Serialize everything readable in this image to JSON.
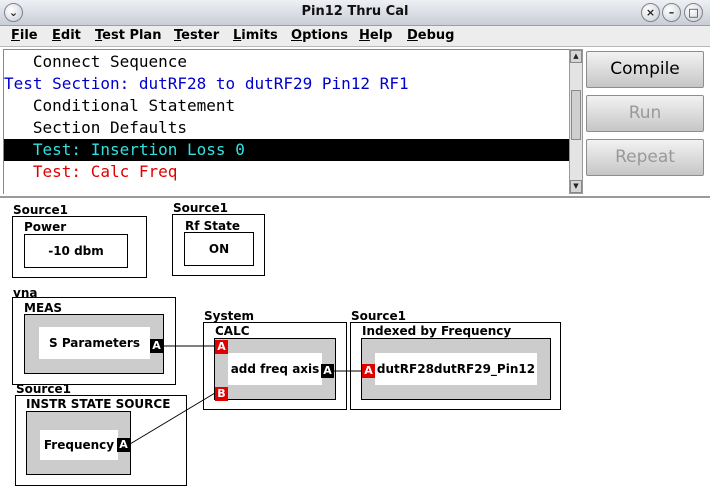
{
  "window": {
    "title": "Pin12 Thru Cal"
  },
  "menu": [
    "File",
    "Edit",
    "Test Plan",
    "Tester",
    "Limits",
    "Options",
    "Help",
    "Debug"
  ],
  "sequence": [
    {
      "text": "   Connect Sequence",
      "color": "#000000",
      "selected": false
    },
    {
      "text": "Test Section: dutRF28 to dutRF29 Pin12 RF1",
      "color": "#0000cc",
      "selected": false
    },
    {
      "text": "   Conditional Statement",
      "color": "#000000",
      "selected": false
    },
    {
      "text": "   Section Defaults",
      "color": "#000000",
      "selected": false
    },
    {
      "text": "   Test: Insertion Loss 0",
      "color": "#33e0e0",
      "selected": true
    },
    {
      "text": "   Test: Calc Freq",
      "color": "#e00000",
      "selected": false
    }
  ],
  "buttons": {
    "compile": "Compile",
    "run": "Run",
    "repeat": "Repeat"
  },
  "colors": {
    "button_disabled_text": "#999999",
    "selection_bg": "#000000"
  },
  "blocks": {
    "power": {
      "group": "Source1",
      "name": "Power",
      "value": "-10 dbm"
    },
    "rfstate": {
      "group": "Source1",
      "name": "Rf State",
      "value": "ON"
    },
    "meas": {
      "group": "vna",
      "name": "MEAS",
      "value": "S Parameters",
      "port": "A"
    },
    "calc": {
      "group": "System",
      "name": "CALC",
      "value": "add freq axis",
      "port_out": "A",
      "port_in_a": "A",
      "port_in_b": "B"
    },
    "indexed": {
      "group": "Source1",
      "name": "Indexed by Frequency",
      "value": "dutRF28dutRF29_Pin12",
      "port_in": "A"
    },
    "instr": {
      "group": "Source1",
      "name": "INSTR STATE SOURCE",
      "value": "Frequency",
      "port": "A"
    }
  }
}
